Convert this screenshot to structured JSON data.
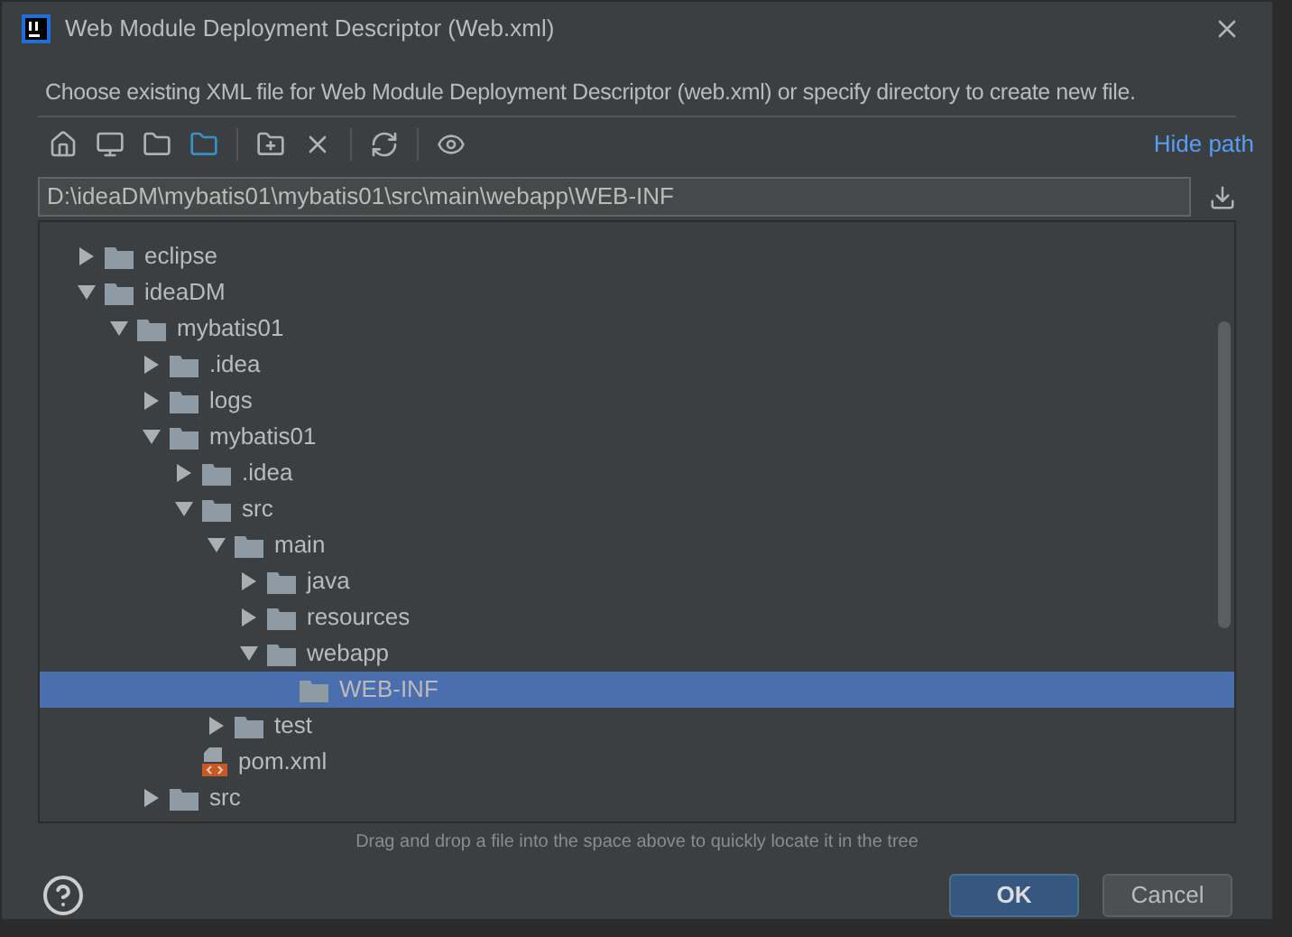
{
  "window": {
    "title": "Web Module Deployment Descriptor (Web.xml)"
  },
  "description": "Choose existing XML file for Web Module Deployment Descriptor (web.xml) or specify directory to create new file.",
  "toolbar": {
    "hide_path_link": "Hide path"
  },
  "path_field": {
    "value": "D:\\ideaDM\\mybatis01\\mybatis01\\src\\main\\webapp\\WEB-INF"
  },
  "tree": [
    {
      "label": "eclipse",
      "kind": "folder",
      "expanded": false,
      "selected": false
    },
    {
      "label": "ideaDM",
      "kind": "folder",
      "expanded": true,
      "selected": false,
      "children": [
        {
          "label": "mybatis01",
          "kind": "folder",
          "expanded": true,
          "selected": false,
          "children": [
            {
              "label": ".idea",
              "kind": "folder",
              "expanded": false,
              "selected": false
            },
            {
              "label": "logs",
              "kind": "folder",
              "expanded": false,
              "selected": false
            },
            {
              "label": "mybatis01",
              "kind": "folder",
              "expanded": true,
              "selected": false,
              "children": [
                {
                  "label": ".idea",
                  "kind": "folder",
                  "expanded": false,
                  "selected": false
                },
                {
                  "label": "src",
                  "kind": "folder",
                  "expanded": true,
                  "selected": false,
                  "children": [
                    {
                      "label": "main",
                      "kind": "folder",
                      "expanded": true,
                      "selected": false,
                      "children": [
                        {
                          "label": "java",
                          "kind": "folder",
                          "expanded": false,
                          "selected": false
                        },
                        {
                          "label": "resources",
                          "kind": "folder",
                          "expanded": false,
                          "selected": false
                        },
                        {
                          "label": "webapp",
                          "kind": "folder",
                          "expanded": true,
                          "selected": false,
                          "children": [
                            {
                              "label": "WEB-INF",
                              "kind": "leaf-folder",
                              "selected": true
                            }
                          ]
                        }
                      ]
                    },
                    {
                      "label": "test",
                      "kind": "folder",
                      "expanded": false,
                      "selected": false
                    }
                  ]
                },
                {
                  "label": "pom.xml",
                  "kind": "xml-file",
                  "selected": false
                }
              ]
            },
            {
              "label": "src",
              "kind": "folder",
              "expanded": false,
              "selected": false
            }
          ]
        }
      ]
    }
  ],
  "hint": "Drag and drop a file into the space above to quickly locate it in the tree",
  "buttons": [
    {
      "label": "OK",
      "kind": "primary"
    },
    {
      "label": "Cancel",
      "kind": "secondary"
    }
  ]
}
